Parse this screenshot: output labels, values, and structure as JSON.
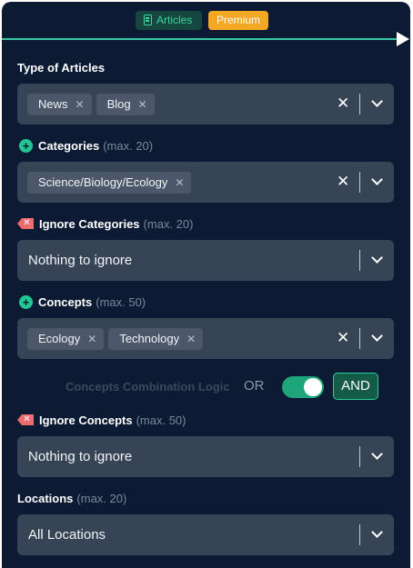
{
  "tabs": {
    "articles": "Articles",
    "premium": "Premium"
  },
  "type_of_articles": {
    "label": "Type of Articles",
    "chips": [
      "News",
      "Blog"
    ]
  },
  "categories": {
    "label": "Categories",
    "max": "(max. 20)",
    "chips": [
      "Science/Biology/Ecology"
    ]
  },
  "ignore_categories": {
    "label": "Ignore Categories",
    "max": "(max. 20)",
    "placeholder": "Nothing to ignore"
  },
  "concepts": {
    "label": "Concepts",
    "max": "(max. 50)",
    "chips": [
      "Ecology",
      "Technology"
    ]
  },
  "logic": {
    "label": "Concepts Combination Logic",
    "or": "OR",
    "and": "AND",
    "selected": "AND"
  },
  "ignore_concepts": {
    "label": "Ignore Concepts",
    "max": "(max. 50)",
    "placeholder": "Nothing to ignore"
  },
  "locations": {
    "label": "Locations",
    "max": "(max. 20)",
    "placeholder": "All Locations"
  },
  "colors": {
    "panel": "#0c1b33",
    "accent": "#23c595",
    "premium": "#f3a723",
    "ignore": "#ee6b6b"
  },
  "icons": {
    "add": "plus-circle-icon",
    "ignore": "ignore-tag-icon",
    "clear": "close-icon",
    "dropdown": "chevron-down-icon"
  }
}
